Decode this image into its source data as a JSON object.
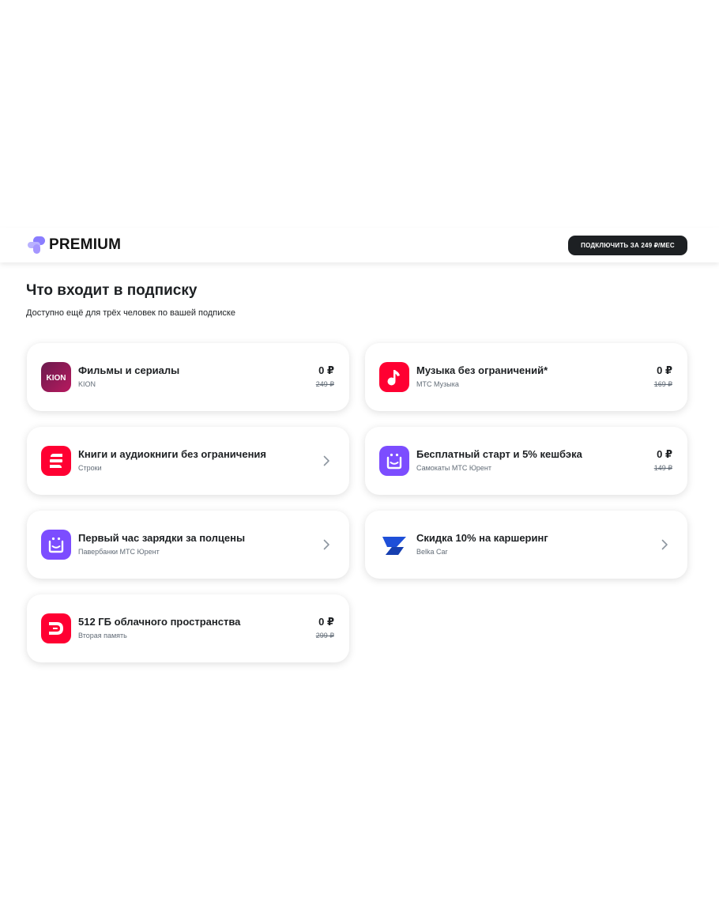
{
  "header": {
    "logo_text": "PREMIUM",
    "connect_button": "ПОДКЛЮЧИТЬ ЗА 249 ₽/МЕС"
  },
  "main": {
    "title": "Что входит в подписку",
    "subtitle": "Доступно ещё для трёх человек по вашей подписке"
  },
  "services": [
    {
      "title": "Фильмы и сериалы",
      "provider": "KION",
      "price": "0 ₽",
      "old_price": "249 ₽",
      "icon": "kion-icon",
      "icon_text": "KION"
    },
    {
      "title": "Музыка без ограничений*",
      "provider": "МТС Музыка",
      "price": "0 ₽",
      "old_price": "169 ₽",
      "icon": "mts-music-icon"
    },
    {
      "title": "Книги и аудиокниги без ограничения",
      "provider": "Строки",
      "icon": "stroki-icon"
    },
    {
      "title": "Бесплатный старт и 5% кешбэка",
      "provider": "Самокаты МТС Юрент",
      "price": "0 ₽",
      "old_price": "149 ₽",
      "icon": "urent-icon"
    },
    {
      "title": "Первый час зарядки за полцены",
      "provider": "Павербанки МТС Юрент",
      "icon": "urent-icon"
    },
    {
      "title": "Скидка 10% на каршеринг",
      "provider": "Belka Car",
      "icon": "belka-car-icon"
    },
    {
      "title": "512 ГБ облачного пространства",
      "provider": "Вторая память",
      "price": "0 ₽",
      "old_price": "299 ₽",
      "icon": "cloud-storage-icon"
    }
  ],
  "colors": {
    "accent_red": "#ff0032",
    "urent_purple": "#7c4dff",
    "kion_gradient": [
      "#6a1b4d",
      "#b8195f"
    ],
    "belka_blue": "#1e4fd8",
    "button_dark": "#1d2023",
    "logo_purple": "#8a7dff"
  }
}
